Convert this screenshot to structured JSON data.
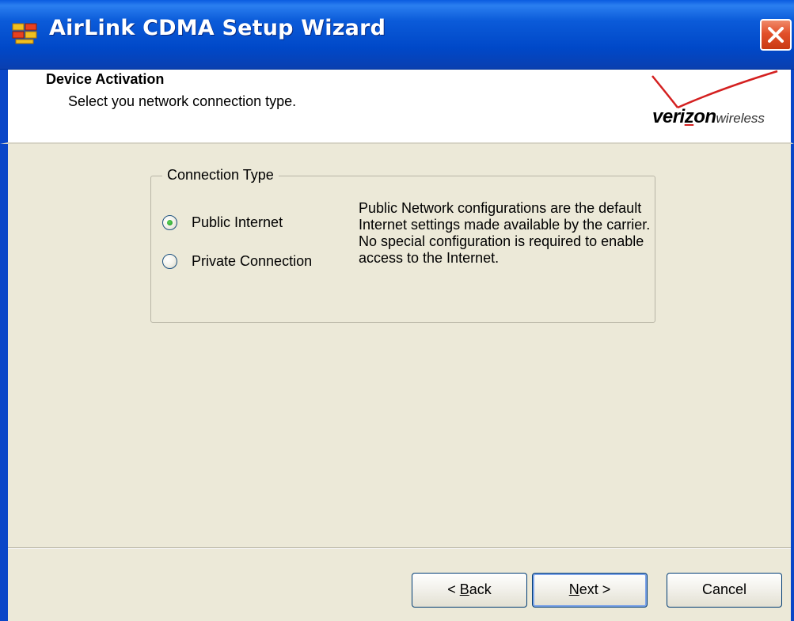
{
  "window": {
    "title": "AirLink CDMA Setup Wizard",
    "close_icon": "close-icon",
    "app_icon": "airlink-app-icon"
  },
  "header": {
    "title": "Device Activation",
    "subtitle": "Select you network connection type.",
    "logo": {
      "brand": "verizon",
      "brand_pre": "veri",
      "brand_z": "z",
      "brand_post": "on",
      "suffix": "wireless",
      "check_color": "#d42020"
    }
  },
  "connection_type": {
    "legend": "Connection Type",
    "options": [
      {
        "label": "Public Internet",
        "selected": true
      },
      {
        "label": "Private Connection",
        "selected": false
      }
    ],
    "description": "Public Network configurations are the default Internet settings made available by the carrier. No special configuration is required to enable access to the Internet."
  },
  "buttons": {
    "back": {
      "label": "< Back",
      "prefix": "< ",
      "mnemonic": "B",
      "rest": "ack"
    },
    "next": {
      "label": "Next >",
      "mnemonic": "N",
      "rest": "ext >"
    },
    "cancel": {
      "label": "Cancel"
    }
  },
  "colors": {
    "titlebar": "#0a5be0",
    "dialog_background": "#ece9d8",
    "close_button": "#e2502a",
    "radio_dot": "#21a121"
  }
}
